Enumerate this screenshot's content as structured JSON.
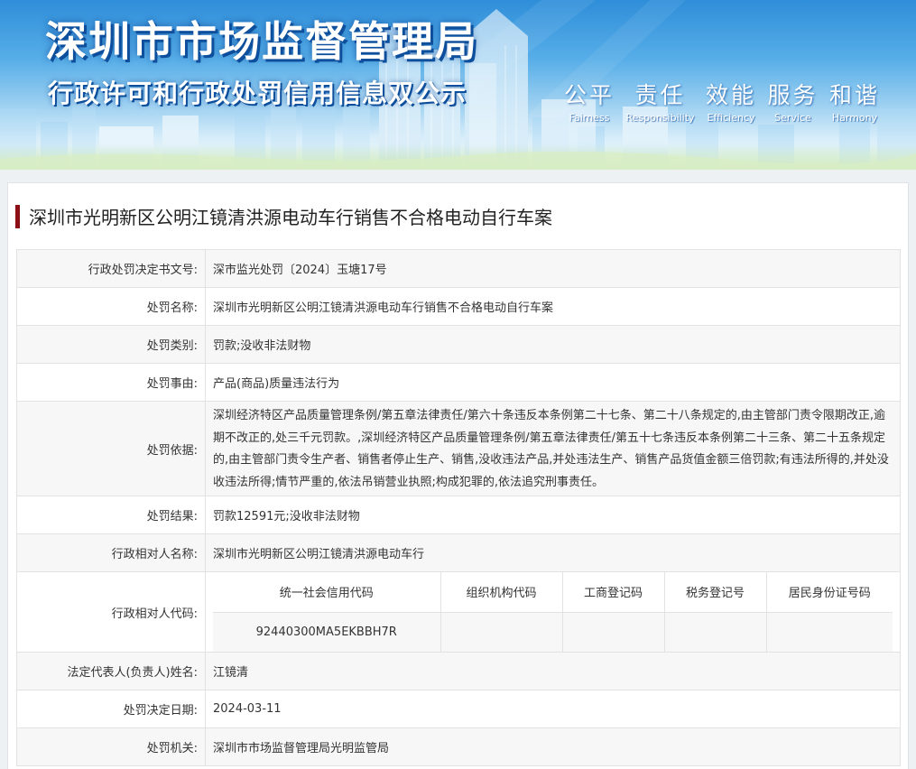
{
  "banner": {
    "title": "深圳市市场监督管理局",
    "subtitle": "行政许可和行政处罚信用信息双公示",
    "slogans": [
      {
        "cn": "公平",
        "en": "Fairness"
      },
      {
        "cn": "责任",
        "en": "Responsibility"
      },
      {
        "cn": "效能",
        "en": "Efficiency"
      },
      {
        "cn": "服务",
        "en": "Service"
      },
      {
        "cn": "和谐",
        "en": "Harmony"
      }
    ]
  },
  "case": {
    "title": "深圳市光明新区公明江镜清洪源电动车行销售不合格电动自行车案"
  },
  "rows": {
    "decision_no": {
      "label": "行政处罚决定书文号:",
      "value": "深市监光处罚〔2024〕玉塘17号"
    },
    "penalty_name": {
      "label": "处罚名称:",
      "value": "深圳市光明新区公明江镜清洪源电动车行销售不合格电动自行车案"
    },
    "penalty_type": {
      "label": "处罚类别:",
      "value": "罚款;没收非法财物"
    },
    "penalty_reason": {
      "label": "处罚事由:",
      "value": "产品(商品)质量违法行为"
    },
    "penalty_basis": {
      "label": "处罚依据:",
      "value": "深圳经济特区产品质量管理条例/第五章法律责任/第六十条违反本条例第二十七条、第二十八条规定的,由主管部门责令限期改正,逾期不改正的,处三千元罚款。,深圳经济特区产品质量管理条例/第五章法律责任/第五十七条违反本条例第二十三条、第二十五条规定的,由主管部门责令生产者、销售者停止生产、销售,没收违法产品,并处违法生产、销售产品货值金额三倍罚款;有违法所得的,并处没收违法所得;情节严重的,依法吊销营业执照;构成犯罪的,依法追究刑事责任。"
    },
    "penalty_result": {
      "label": "处罚结果:",
      "value": "罚款12591元;没收非法财物"
    },
    "party_name": {
      "label": "行政相对人名称:",
      "value": "深圳市光明新区公明江镜清洪源电动车行"
    },
    "party_code": {
      "label": "行政相对人代码:",
      "headers": [
        "统一社会信用代码",
        "组织机构代码",
        "工商登记码",
        "税务登记号",
        "居民身份证号码"
      ],
      "values": [
        "92440300MA5EKBBH7R",
        "",
        "",
        "",
        ""
      ]
    },
    "legal_rep": {
      "label": "法定代表人(负责人)姓名:",
      "value": "江镜清"
    },
    "decision_date": {
      "label": "处罚决定日期:",
      "value": "2024-03-11"
    },
    "authority": {
      "label": "处罚机关:",
      "value": "深圳市市场监督管理局光明监管局"
    }
  }
}
